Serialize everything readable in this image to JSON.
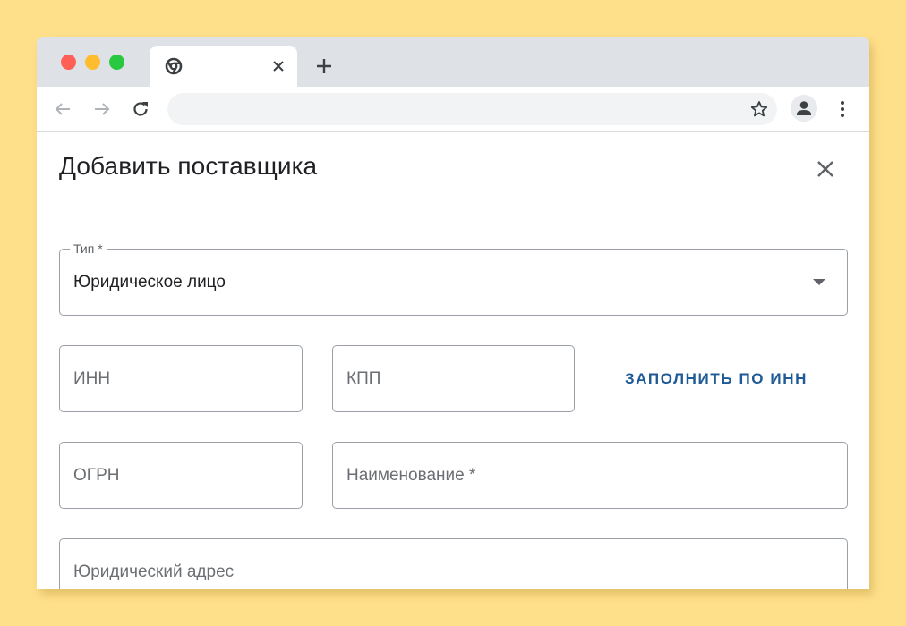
{
  "browser": {
    "tab": {
      "favicon": "chrome-icon",
      "close_icon": "close-icon"
    },
    "new_tab_icon": "plus-icon",
    "toolbar": {
      "back_icon": "arrow-left-icon",
      "forward_icon": "arrow-right-icon",
      "reload_icon": "reload-icon",
      "address": "",
      "bookmark_icon": "star-icon",
      "profile_icon": "person-icon",
      "menu_icon": "more-vert-icon"
    },
    "traffic_lights": [
      "#ff5f57",
      "#febc2e",
      "#28c840"
    ]
  },
  "dialog": {
    "title": "Добавить поставщика",
    "close_icon": "close-icon",
    "type_field": {
      "label": "Тип *",
      "value": "Юридическое лицо"
    },
    "inn_field": {
      "placeholder": "ИНН"
    },
    "kpp_field": {
      "placeholder": "КПП"
    },
    "fill_by_inn_button": "ЗАПОЛНИТЬ ПО ИНН",
    "ogrn_field": {
      "placeholder": "ОГРН"
    },
    "name_field": {
      "placeholder": "Наименование *"
    },
    "address_field": {
      "placeholder": "Юридический адрес"
    }
  },
  "colors": {
    "background": "#ffe08a",
    "accent": "#1e5a96",
    "border": "#9aa0a6"
  }
}
